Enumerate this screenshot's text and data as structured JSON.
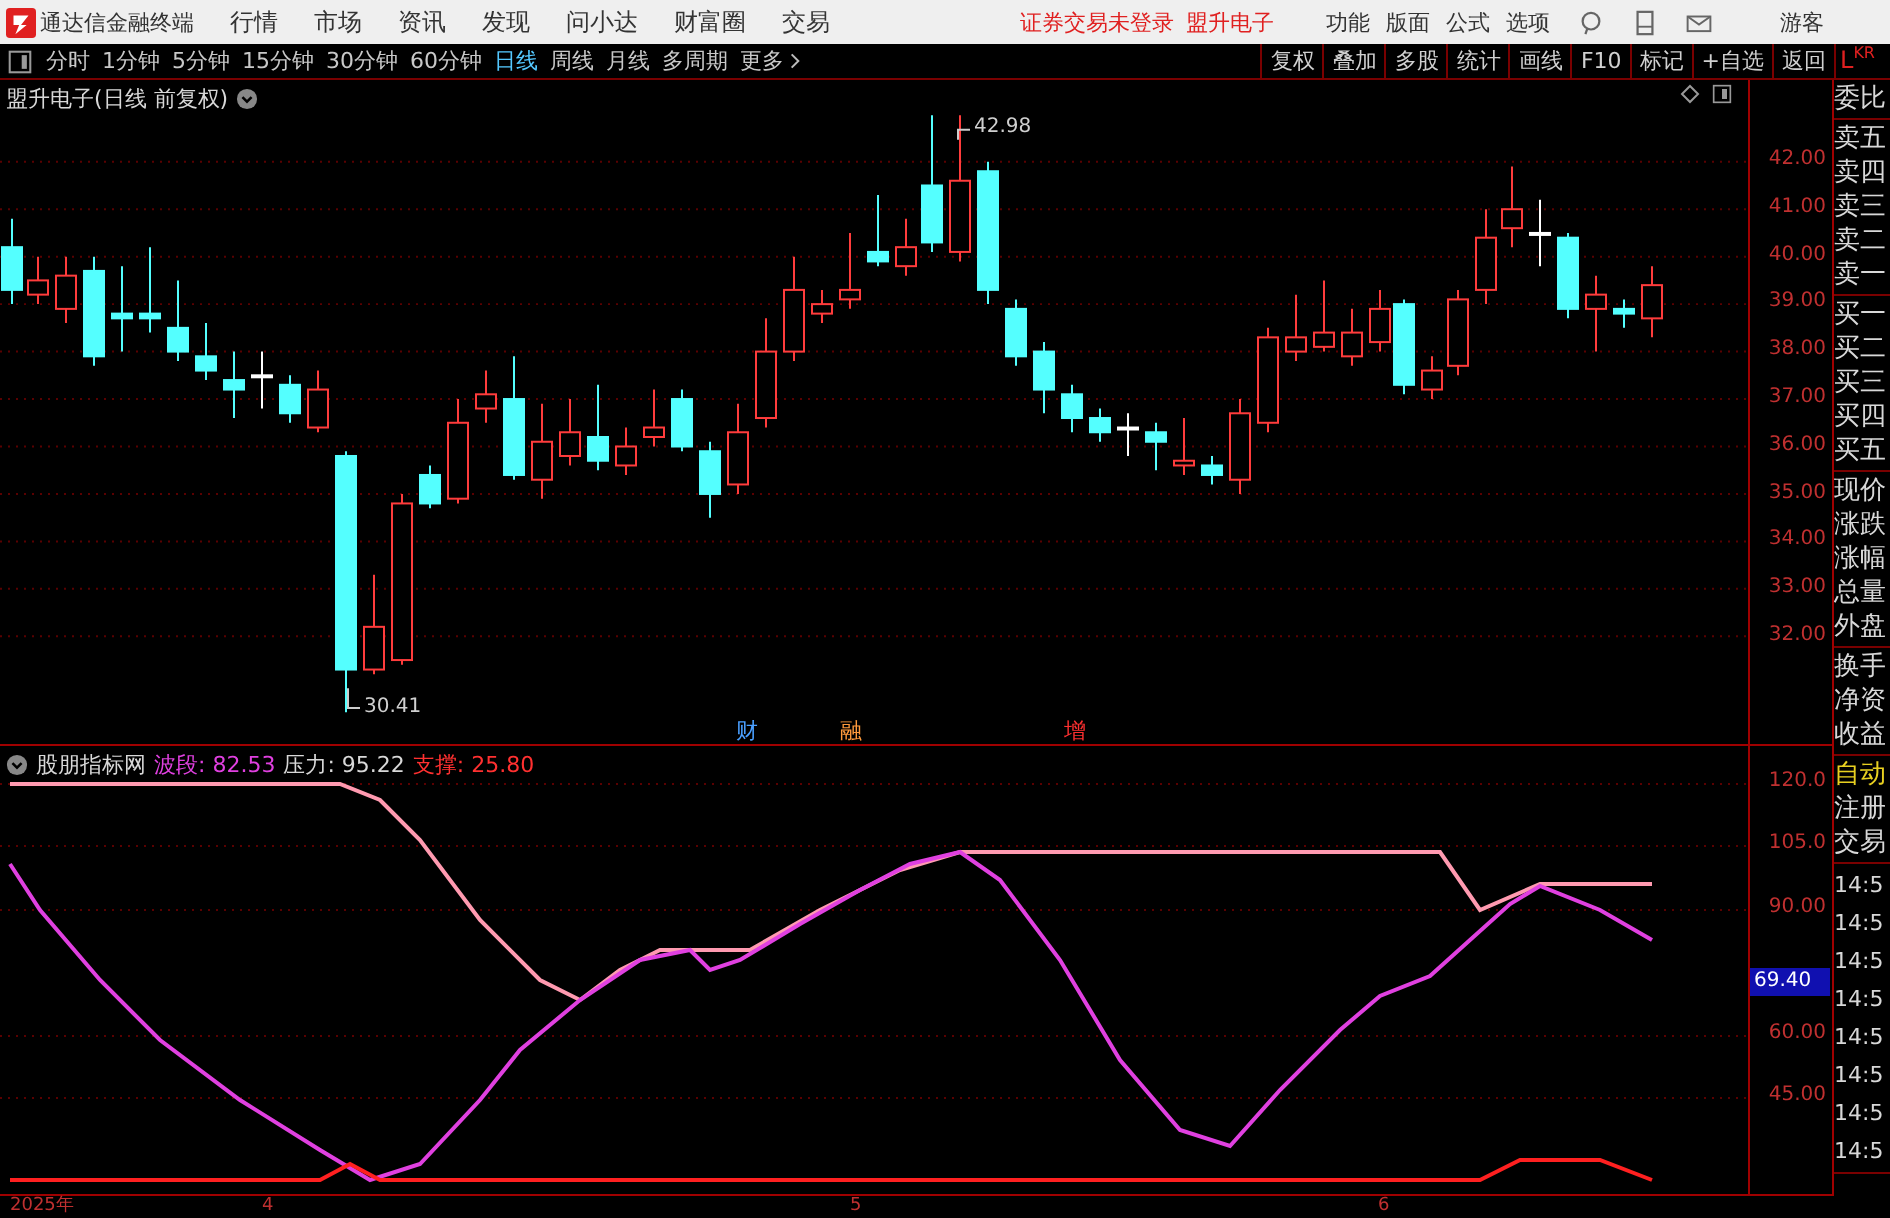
{
  "menu_bar": {
    "app_title": "通达信金融终端",
    "menus": [
      "行情",
      "市场",
      "资讯",
      "发现",
      "问小达",
      "财富圈",
      "交易"
    ],
    "login_status": "证券交易未登录",
    "stock_name": "盟升电子",
    "tools": [
      "功能",
      "版面",
      "公式",
      "选项"
    ],
    "user": "游客"
  },
  "period_tabs": [
    {
      "label": "分时",
      "selected": false
    },
    {
      "label": "1分钟",
      "selected": false
    },
    {
      "label": "5分钟",
      "selected": false
    },
    {
      "label": "15分钟",
      "selected": false
    },
    {
      "label": "30分钟",
      "selected": false
    },
    {
      "label": "60分钟",
      "selected": false
    },
    {
      "label": "日线",
      "selected": true
    },
    {
      "label": "周线",
      "selected": false
    },
    {
      "label": "月线",
      "selected": false
    },
    {
      "label": "多周期",
      "selected": false
    }
  ],
  "more_button": "更多",
  "toolbar_buttons": [
    "复权",
    "叠加",
    "多股",
    "统计",
    "画线",
    "F10",
    "标记",
    "+自选",
    "返回"
  ],
  "price_chart": {
    "title": "盟升电子(日线 前复权)",
    "high_label": "42.98",
    "low_label": "30.41",
    "y_ticks": [
      "42.00",
      "41.00",
      "40.00",
      "39.00",
      "38.00",
      "37.00",
      "36.00",
      "35.00",
      "34.00",
      "33.00",
      "32.00"
    ],
    "markers": [
      {
        "text": "财",
        "color": "#4a9fff"
      },
      {
        "text": "融",
        "color": "#ff9a3c"
      },
      {
        "text": "增",
        "color": "#ff3030"
      }
    ]
  },
  "indicator": {
    "name": "股朋指标网",
    "readings": [
      {
        "text": "波段: 82.53",
        "color": "#e040e0"
      },
      {
        "text": "压力: 95.22",
        "color": "#d8d8d8"
      },
      {
        "text": "支撑: 25.80",
        "color": "#ff3030"
      }
    ],
    "y_ticks": [
      "120.0",
      "105.0",
      "90.00",
      "60.00",
      "45.00"
    ],
    "current_value": "69.40"
  },
  "x_axis": [
    "2025年",
    "4",
    "5",
    "6"
  ],
  "side_panel": {
    "header_letter": "L",
    "header_code": "KR",
    "groups": [
      [
        {
          "text": "委比",
          "kind": "label"
        }
      ],
      [
        {
          "text": "卖五",
          "kind": "label"
        },
        {
          "text": "卖四",
          "kind": "label"
        },
        {
          "text": "卖三",
          "kind": "label"
        },
        {
          "text": "卖二",
          "kind": "label"
        },
        {
          "text": "卖一",
          "kind": "label"
        }
      ],
      [
        {
          "text": "买一",
          "kind": "label"
        },
        {
          "text": "买二",
          "kind": "label"
        },
        {
          "text": "买三",
          "kind": "label"
        },
        {
          "text": "买四",
          "kind": "label"
        },
        {
          "text": "买五",
          "kind": "label"
        }
      ],
      [
        {
          "text": "现价",
          "kind": "label"
        },
        {
          "text": "涨跌",
          "kind": "label"
        },
        {
          "text": "涨幅",
          "kind": "label"
        },
        {
          "text": "总量",
          "kind": "label"
        },
        {
          "text": "外盘",
          "kind": "label"
        }
      ],
      [
        {
          "text": "换手",
          "kind": "label"
        },
        {
          "text": "净资",
          "kind": "label"
        },
        {
          "text": "收益",
          "kind": "label"
        }
      ],
      [
        {
          "text": "自动",
          "kind": "active"
        },
        {
          "text": "注册",
          "kind": "label"
        },
        {
          "text": "交易",
          "kind": "label"
        }
      ],
      [
        {
          "text": "14:5",
          "kind": "time"
        },
        {
          "text": "14:5",
          "kind": "time"
        },
        {
          "text": "14:5",
          "kind": "time"
        },
        {
          "text": "14:5",
          "kind": "time"
        },
        {
          "text": "14:5",
          "kind": "time"
        },
        {
          "text": "14:5",
          "kind": "time"
        },
        {
          "text": "14:5",
          "kind": "time"
        },
        {
          "text": "14:5",
          "kind": "time"
        }
      ]
    ]
  }
}
